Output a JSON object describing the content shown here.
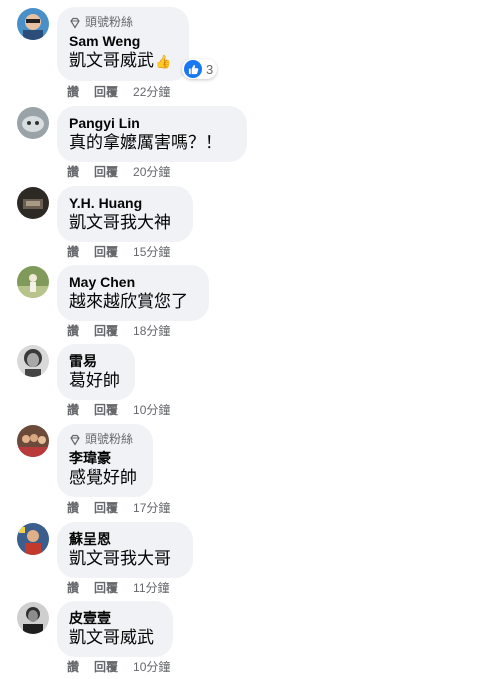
{
  "colors": {
    "bubble": "#f0f2f5",
    "meta": "#65676b",
    "like": "#1877f2"
  },
  "badge_label": "頭號粉絲",
  "action_read": "讚",
  "action_reply": "回覆",
  "comments": [
    {
      "name": "Sam Weng",
      "text": "凱文哥威武",
      "emoji": "👍",
      "time": "22分鐘",
      "badge": true,
      "reactions": "3",
      "avatar_icon": "avatar-sam-weng"
    },
    {
      "name": "Pangyi Lin",
      "text": "真的拿嬤厲害嗎？！",
      "time": "20分鐘",
      "badge": false,
      "avatar_icon": "avatar-pangyi-lin"
    },
    {
      "name": "Y.H. Huang",
      "text": "凱文哥我大神",
      "time": "15分鐘",
      "badge": false,
      "avatar_icon": "avatar-yh-huang"
    },
    {
      "name": "May Chen",
      "text": "越來越欣賞您了",
      "time": "18分鐘",
      "badge": false,
      "avatar_icon": "avatar-may-chen"
    },
    {
      "name": "雷易",
      "text": "葛好帥",
      "time": "10分鐘",
      "badge": false,
      "avatar_icon": "avatar-lei-yi"
    },
    {
      "name": "李瑋豪",
      "text": "感覺好帥",
      "time": "17分鐘",
      "badge": true,
      "avatar_icon": "avatar-li-weihao"
    },
    {
      "name": "蘇呈恩",
      "text": "凱文哥我大哥",
      "time": "11分鐘",
      "badge": false,
      "avatar_icon": "avatar-su-chengen"
    },
    {
      "name": "皮壹壹",
      "text": "凱文哥威武",
      "time": "10分鐘",
      "badge": false,
      "avatar_icon": "avatar-pi-yiyi"
    }
  ]
}
